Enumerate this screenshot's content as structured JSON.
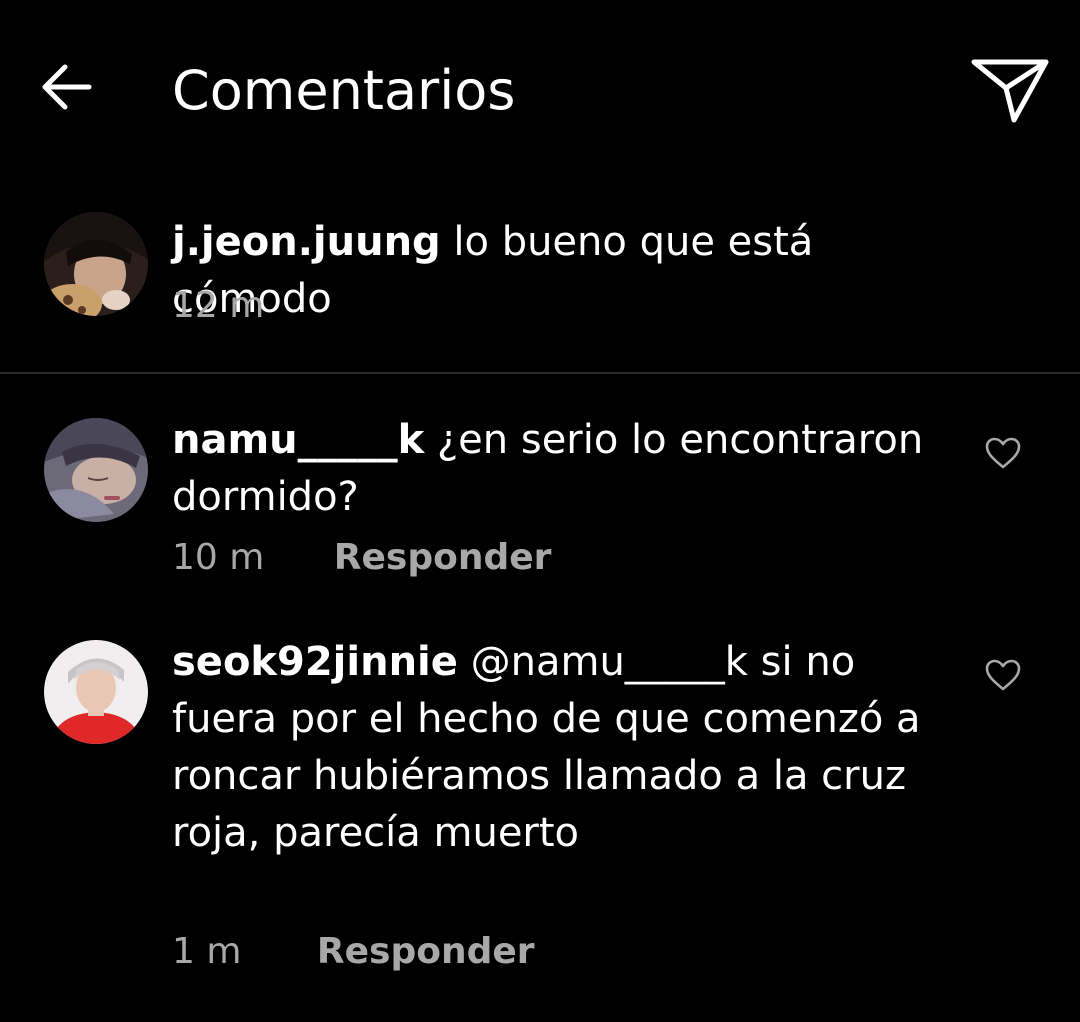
{
  "header": {
    "title": "Comentarios",
    "back_icon": "arrow-left-icon",
    "send_icon": "paper-plane-icon"
  },
  "caption": {
    "username": "j.jeon.juung",
    "text": "lo bueno que está cómodo",
    "time": "12 m"
  },
  "comments": [
    {
      "username": "namu_____k",
      "text": "¿en serio lo encontraron dormido?",
      "time": "10 m",
      "reply_label": "Responder",
      "like_icon": "heart-outline-icon"
    },
    {
      "username": "seok92jinnie",
      "text": "@namu_____k si no fuera por el hecho de que comenzó a roncar hubiéramos llamado a la cruz roja, parecía muerto",
      "time": "1 m",
      "reply_label": "Responder",
      "like_icon": "heart-outline-icon"
    }
  ],
  "colors": {
    "background": "#000000",
    "text_primary": "#ffffff",
    "text_secondary": "#a8a8a8",
    "divider": "#2a2a2a"
  }
}
